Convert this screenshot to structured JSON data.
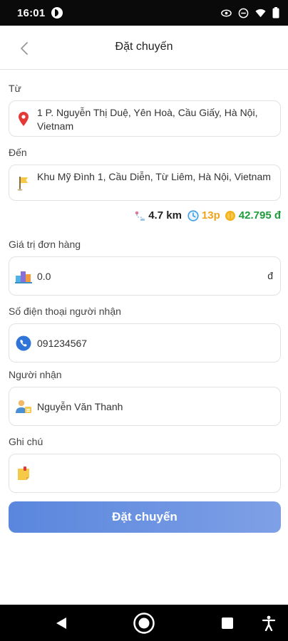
{
  "status_bar": {
    "time": "16:01",
    "icons": [
      "app-icon",
      "eye-icon",
      "do-not-disturb-icon",
      "wifi-icon",
      "battery-icon"
    ]
  },
  "header": {
    "title": "Đặt chuyến",
    "back_icon": "chevron-left-icon"
  },
  "form": {
    "from": {
      "label": "Từ",
      "value": "1 P. Nguyễn Thị Duệ, Yên Hoà, Cầu Giấy, Hà Nội, Vietnam",
      "icon": "map-pin-icon"
    },
    "to": {
      "label": "Đến",
      "value": "Khu Mỹ Đình 1, Cầu Diễn, Từ Liêm, Hà Nội, Vietnam",
      "icon": "flag-icon"
    },
    "trip_info": {
      "distance": "4.7 km",
      "duration": "13p",
      "price": "42.795 đ"
    },
    "order_value": {
      "label": "Giá trị đơn hàng",
      "value": "0.0",
      "unit": "đ",
      "icon": "boxes-icon"
    },
    "recipient_phone": {
      "label": "Số điện thoại người nhận",
      "value": "091234567",
      "icon": "phone-icon"
    },
    "recipient_name": {
      "label": "Người nhận",
      "value": "Nguyễn Văn Thanh",
      "icon": "person-icon"
    },
    "note": {
      "label": "Ghi chú",
      "value": "",
      "icon": "note-icon"
    }
  },
  "submit_label": "Đặt chuyến",
  "colors": {
    "accent": "#5a86dd",
    "time": "#f0a21a",
    "price": "#1f9c3c",
    "pin": "#e53935"
  }
}
